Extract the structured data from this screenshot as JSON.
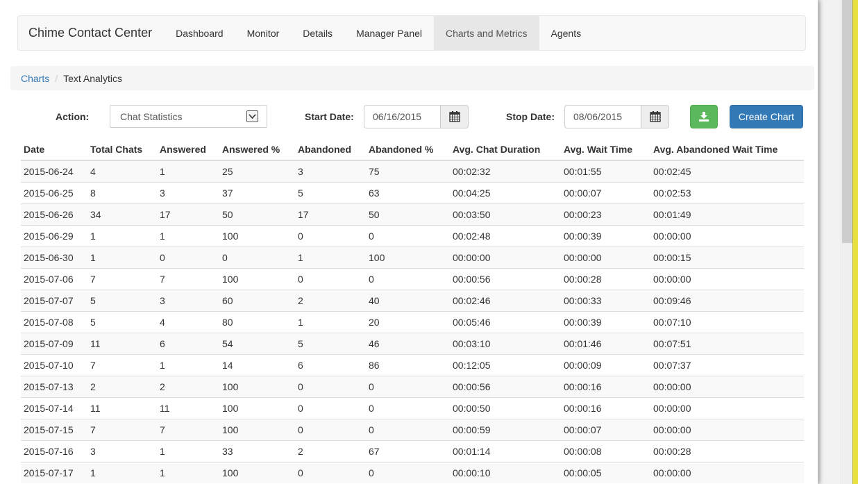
{
  "navbar": {
    "brand": "Chime Contact Center",
    "items": [
      "Dashboard",
      "Monitor",
      "Details",
      "Manager Panel",
      "Charts and Metrics",
      "Agents"
    ],
    "active": "Charts and Metrics"
  },
  "breadcrumb": {
    "link": "Charts",
    "separator": "/",
    "current": "Text Analytics"
  },
  "controls": {
    "action_label": "Action:",
    "action_value": "Chat Statistics",
    "start_label": "Start Date:",
    "start_value": "06/16/2015",
    "stop_label": "Stop Date:",
    "stop_value": "08/06/2015",
    "create_label": "Create Chart"
  },
  "table": {
    "headers": [
      "Date",
      "Total Chats",
      "Answered",
      "Answered %",
      "Abandoned",
      "Abandoned %",
      "Avg. Chat Duration",
      "Avg. Wait Time",
      "Avg. Abandoned Wait Time"
    ],
    "rows": [
      [
        "2015-06-24",
        "4",
        "1",
        "25",
        "3",
        "75",
        "00:02:32",
        "00:01:55",
        "00:02:45"
      ],
      [
        "2015-06-25",
        "8",
        "3",
        "37",
        "5",
        "63",
        "00:04:25",
        "00:00:07",
        "00:02:53"
      ],
      [
        "2015-06-26",
        "34",
        "17",
        "50",
        "17",
        "50",
        "00:03:50",
        "00:00:23",
        "00:01:49"
      ],
      [
        "2015-06-29",
        "1",
        "1",
        "100",
        "0",
        "0",
        "00:02:48",
        "00:00:39",
        "00:00:00"
      ],
      [
        "2015-06-30",
        "1",
        "0",
        "0",
        "1",
        "100",
        "00:00:00",
        "00:00:00",
        "00:00:15"
      ],
      [
        "2015-07-06",
        "7",
        "7",
        "100",
        "0",
        "0",
        "00:00:56",
        "00:00:28",
        "00:00:00"
      ],
      [
        "2015-07-07",
        "5",
        "3",
        "60",
        "2",
        "40",
        "00:02:46",
        "00:00:33",
        "00:09:46"
      ],
      [
        "2015-07-08",
        "5",
        "4",
        "80",
        "1",
        "20",
        "00:05:46",
        "00:00:39",
        "00:07:10"
      ],
      [
        "2015-07-09",
        "11",
        "6",
        "54",
        "5",
        "46",
        "00:03:10",
        "00:01:46",
        "00:07:51"
      ],
      [
        "2015-07-10",
        "7",
        "1",
        "14",
        "6",
        "86",
        "00:12:05",
        "00:00:09",
        "00:07:37"
      ],
      [
        "2015-07-13",
        "2",
        "2",
        "100",
        "0",
        "0",
        "00:00:56",
        "00:00:16",
        "00:00:00"
      ],
      [
        "2015-07-14",
        "11",
        "11",
        "100",
        "0",
        "0",
        "00:00:50",
        "00:00:16",
        "00:00:00"
      ],
      [
        "2015-07-15",
        "7",
        "7",
        "100",
        "0",
        "0",
        "00:00:59",
        "00:00:07",
        "00:00:00"
      ],
      [
        "2015-07-16",
        "3",
        "1",
        "33",
        "2",
        "67",
        "00:01:14",
        "00:00:08",
        "00:00:28"
      ],
      [
        "2015-07-17",
        "1",
        "1",
        "100",
        "0",
        "0",
        "00:00:10",
        "00:00:05",
        "00:00:00"
      ]
    ]
  },
  "colors": {
    "link": "#337ab7",
    "primary_button": "#337ab7",
    "success_button": "#5cb85c",
    "nav_active_bg": "#e7e7e7"
  },
  "icons": {
    "select_arrow": "chevron-down-icon",
    "calendar": "calendar-icon",
    "download": "download-icon"
  }
}
